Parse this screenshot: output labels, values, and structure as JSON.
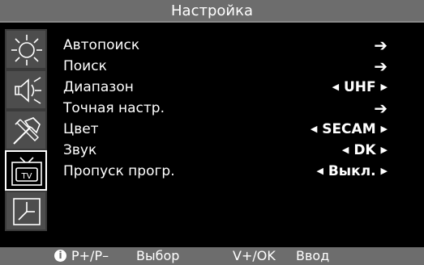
{
  "header": {
    "title": "Настройка"
  },
  "sidebar": {
    "icons": [
      "brightness-icon",
      "speaker-icon",
      "tools-icon",
      "tv-icon",
      "timer-icon"
    ],
    "active": "tv-icon"
  },
  "menu": {
    "items": [
      {
        "label": "Автопоиск",
        "value": ""
      },
      {
        "label": "Поиск",
        "value": ""
      },
      {
        "label": "Диапазон",
        "value": "UHF"
      },
      {
        "label": "Точная настр.",
        "value": ""
      },
      {
        "label": "Цвет",
        "value": "SECAM"
      },
      {
        "label": "Звук",
        "value": "DK"
      },
      {
        "label": "Пропуск прогр.",
        "value": "Выкл."
      }
    ]
  },
  "footer": {
    "info_glyph": "i",
    "hint1_key": "P+/P–",
    "hint1_action": "Выбор",
    "hint2_key": "V+/OK",
    "hint2_action": "Ввод"
  },
  "colors": {
    "background": "#000000",
    "bar": "#6d6d6d",
    "sidebar_tile": "#4d4d4d",
    "text": "#ffffff"
  }
}
